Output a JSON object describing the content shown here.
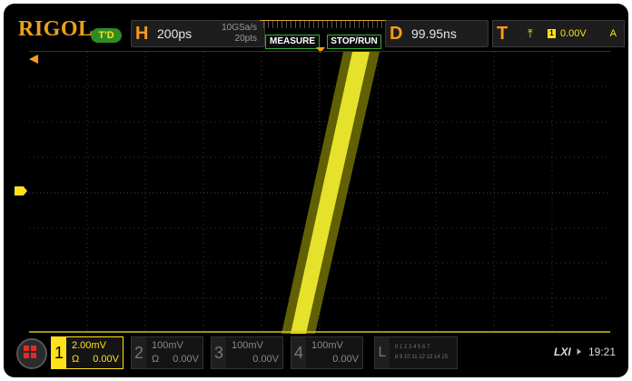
{
  "brand": "RIGOL",
  "trigger_status": "T'D",
  "horizontal": {
    "label": "H",
    "timebase": "200ps",
    "sample_rate": "10GSa/s",
    "memory_depth": "20pts"
  },
  "buttons": {
    "measure": "MEASURE",
    "stop_run": "STOP/RUN"
  },
  "delay": {
    "label": "D",
    "value": "99.95ns"
  },
  "trigger": {
    "label": "T",
    "edge_icon": "rising-edge-icon",
    "source": "1",
    "level": "0.00V",
    "mode": "A"
  },
  "channels": [
    {
      "num": "1",
      "scale": "2.00mV",
      "impedance": "Ω",
      "offset": "0.00V",
      "active": true,
      "color": "#ffe11a"
    },
    {
      "num": "2",
      "scale": "100mV",
      "impedance": "Ω",
      "offset": "0.00V",
      "active": false
    },
    {
      "num": "3",
      "scale": "100mV",
      "impedance": "",
      "offset": "0.00V",
      "active": false
    },
    {
      "num": "4",
      "scale": "100mV",
      "impedance": "",
      "offset": "0.00V",
      "active": false
    }
  ],
  "logic": {
    "label": "L",
    "row1": "0 1 2 3  4 5 6 7",
    "row2": "8 9 10 11 12 13 14 15"
  },
  "status": {
    "lxi": "LXI",
    "speaker_icon": "speaker-muted-icon",
    "time": "19:21"
  },
  "colors": {
    "ch1": "#ffe11a",
    "accent": "#ff9b1a",
    "button_border": "#2fb02f"
  }
}
